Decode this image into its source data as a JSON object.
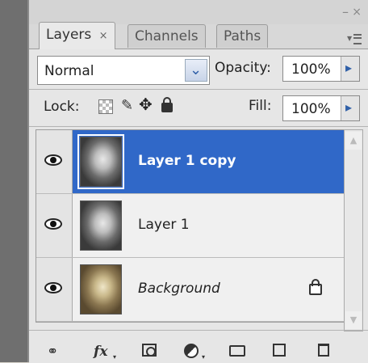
{
  "tabs": [
    {
      "label": "Layers",
      "close": "×"
    },
    {
      "label": "Channels"
    },
    {
      "label": "Paths"
    }
  ],
  "window_controls": {
    "minimize": "–",
    "close": "×"
  },
  "blend_mode": "Normal",
  "opacity": {
    "label": "Opacity:",
    "value": "100%"
  },
  "lock": {
    "label": "Lock:"
  },
  "fill": {
    "label": "Fill:",
    "value": "100%"
  },
  "layers": [
    {
      "name": "Layer 1 copy",
      "visible": true,
      "selected": true,
      "locked": false
    },
    {
      "name": "Layer 1",
      "visible": true,
      "selected": false,
      "locked": false
    },
    {
      "name": "Background",
      "visible": true,
      "selected": false,
      "locked": true
    }
  ],
  "bottom_icons": {
    "link": "link-layers-icon",
    "fx": "fx",
    "mask": "add-mask-icon",
    "adjustment": "adjustment-layer-icon",
    "group": "folder-icon",
    "new": "new-layer-icon",
    "delete": "trash-icon"
  },
  "colors": {
    "selection": "#3068c8",
    "panel": "#d8d8d8",
    "accent_arrow": "#3060a8"
  }
}
